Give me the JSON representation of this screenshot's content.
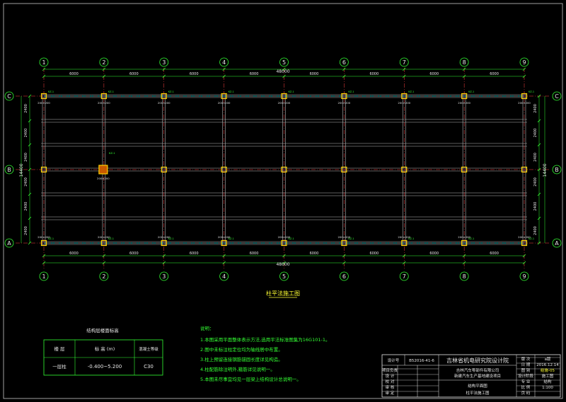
{
  "grid": {
    "x_axes": [
      "1",
      "2",
      "3",
      "4",
      "5",
      "6",
      "7",
      "8",
      "9"
    ],
    "y_axes": [
      "C",
      "B",
      "A"
    ],
    "spacings_x": [
      "6000",
      "6000",
      "6000",
      "6000",
      "6000",
      "6000",
      "6000",
      "6000"
    ],
    "total_x": "48000",
    "spacings_y": [
      "2400",
      "2400",
      "2400",
      "2400",
      "2400",
      "2400"
    ],
    "total_y": "14400",
    "column_size": "200×200",
    "column_tag": "KZ-1"
  },
  "drawing_title": "柱平法施工图",
  "table": {
    "title": "结构层楼面标高",
    "headers": [
      "楼 层",
      "标 高 (m)",
      "混凝土等级"
    ],
    "row": [
      "一层柱",
      "-0.400~5.200",
      "C30"
    ]
  },
  "notes": {
    "title": "说明：",
    "items": [
      "1.本图采用平面整体表示方法,选用平法标准图集为16G101-1。",
      "2.图中未标注柱定位均为轴线居中布置。",
      "3.柱上预留连接钢筋锚固长度详见构造。",
      "4.柱配筋除注明外,箍筋详见说明一。",
      "5.本图未尽事宜均见一层梁上结构设计总说明一。"
    ]
  },
  "title_block": {
    "project_no_label": "设计号",
    "project_no": "B52016-41-6",
    "institute": "吉林省机电研究院设计院",
    "client": "吉林汽车零部件有限公司",
    "project": "新建汽车生产基地建设项目",
    "drawing_name_1": "结构平面图",
    "drawing_name_2": "柱平法施工图",
    "left_rows": [
      "项目负责",
      "设 计",
      "校 对",
      "审 核",
      "审 定"
    ],
    "right_labels": [
      "版 次",
      "日 期",
      "图 别",
      "设计阶段",
      "专 业",
      "比 例",
      "页 码"
    ],
    "version": "a版",
    "date": "2016.12.14",
    "drawing_type": "结施-05",
    "stage": "施工图",
    "discipline": "结构",
    "scale": "1:100"
  },
  "colors": {
    "background": "#000000",
    "grid_line": "#ff4040",
    "beam": "#b8b8b8",
    "column": "#ffd000",
    "column_fill": "#c85a00",
    "axis_bubble": "#33ff33",
    "dimension": "#33ff33",
    "text": "#e8e8e8",
    "notes": "#33ff33",
    "title": "#ffff33",
    "axis_a_highlight": "#00ffff"
  }
}
